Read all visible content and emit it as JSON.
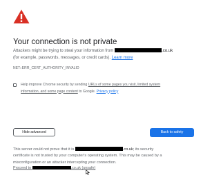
{
  "title": "Your connection is not private",
  "intro": {
    "line1_prefix": "Attackers might be trying to steal your information from",
    "line1_suffix": ".co.uk",
    "line2_prefix": "(for example, passwords, messages, or credit cards).",
    "learn_more": "Learn more"
  },
  "error_code": "NET::ERR_CERT_AUTHORITY_INVALID",
  "improve": {
    "line1_prefix": "Help improve Chrome security by sending",
    "line1_link": "URLs of some pages you visit, limited system",
    "line2_link": "information, and some page content",
    "line2_mid": "to Google.",
    "privacy_link": "Privacy policy"
  },
  "buttons": {
    "advanced": "Hide advanced",
    "back": "Back to safety"
  },
  "details": {
    "line1_prefix": "This server could not prove that it is",
    "line1_suffix": ".co.uk",
    "line1_rest": "; its security",
    "line2": "certificate is not trusted by your computer's operating system. This may be caused by a",
    "line3": "misconfiguration or an attacker intercepting your connection."
  },
  "proceed": {
    "prefix": "Proceed to",
    "suffix": ".co.uk (unsafe)"
  },
  "colors": {
    "warning_red": "#d93025",
    "link_blue": "#1a73e8",
    "button_blue": "#1a73e8",
    "text_gray": "#5f6368",
    "title_dark": "#202124"
  },
  "icons": {
    "warning": "warning-triangle-icon",
    "cursor": "mouse-pointer-icon"
  }
}
